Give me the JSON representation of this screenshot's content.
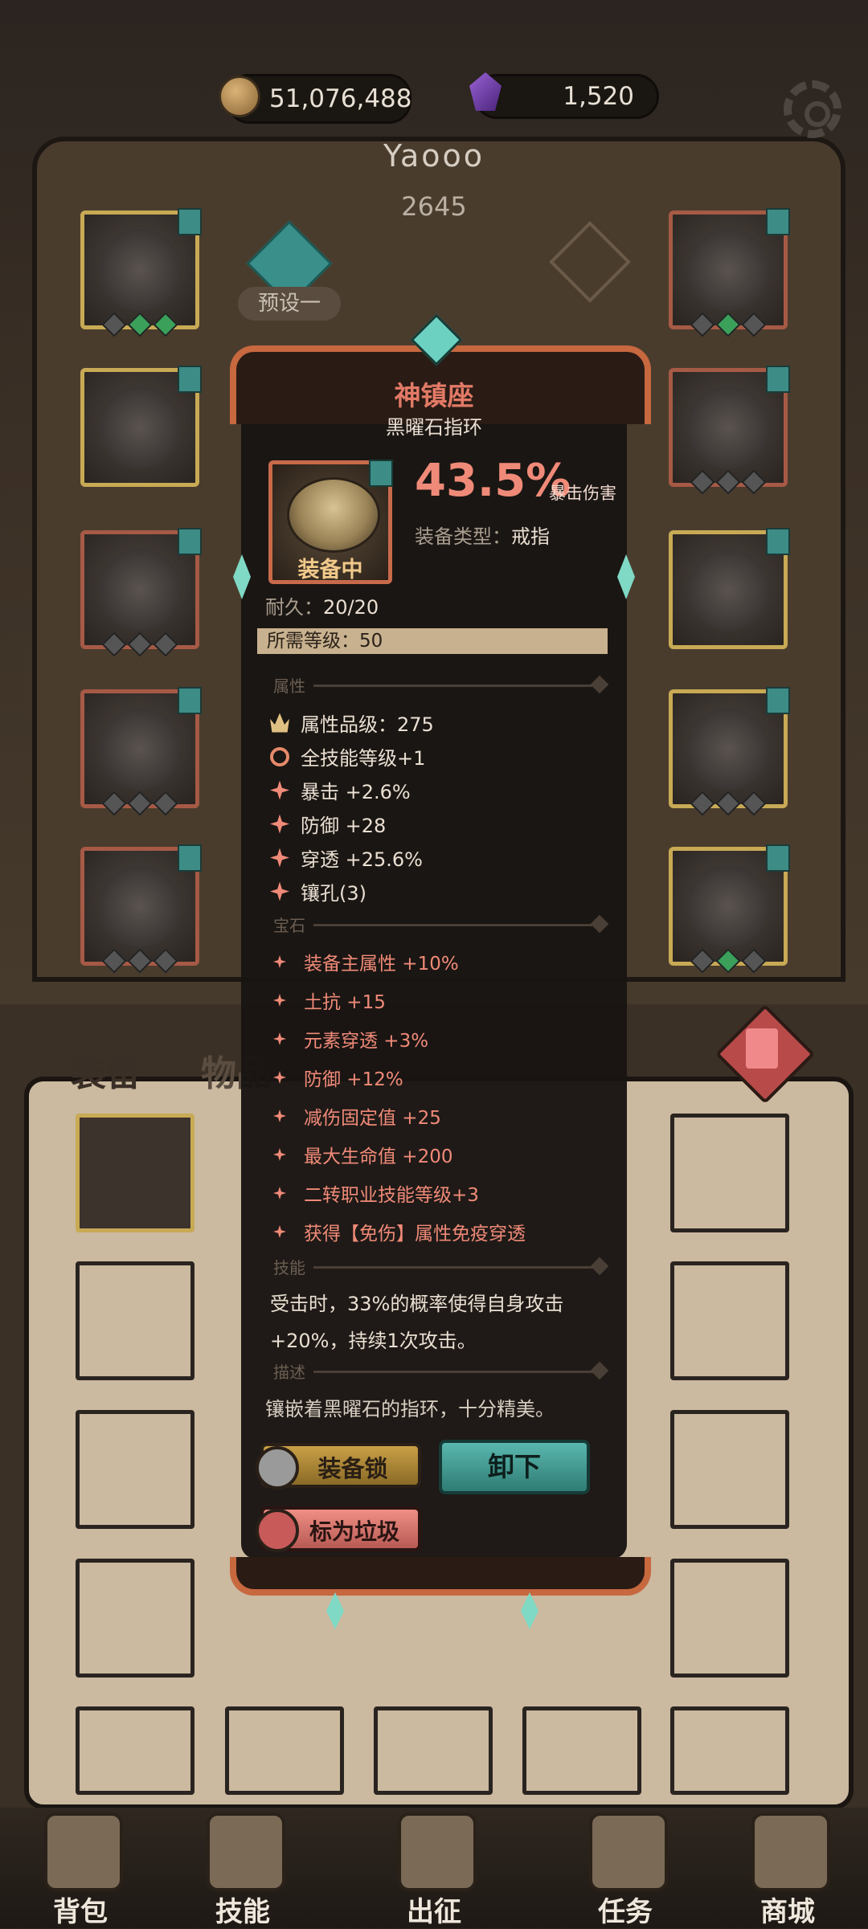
{
  "header": {
    "coins": "51,076,488",
    "gems": "1,520",
    "player_name": "Yaooo",
    "power": "2645",
    "preset_label": "预设一"
  },
  "inventory_tabs": {
    "equip": "装备",
    "items": "物品"
  },
  "tooltip": {
    "title": "神镇座",
    "subtitle": "黑曜石指环",
    "equipped_label": "装备中",
    "main_stat_value": "43.5%",
    "main_stat_label": "暴击伤害",
    "type_label": "装备类型：",
    "type_value": "戒指",
    "durability_label": "耐久：",
    "durability_value": "20/20",
    "level_label": "所需等级：",
    "level_value": "50",
    "sections": {
      "attributes": "属性",
      "gems": "宝石",
      "skill": "技能",
      "description": "描述"
    },
    "attributes": [
      "属性品级：275",
      "全技能等级+1",
      "暴击 +2.6%",
      "防御 +28",
      "穿透 +25.6%",
      "镶孔(3)"
    ],
    "gem_lines": [
      "装备主属性 +10%",
      "土抗 +15",
      "元素穿透 +3%",
      "防御 +12%",
      "减伤固定值 +25",
      "最大生命值 +200",
      "二转职业技能等级+3",
      "获得【免伤】属性免疫穿透"
    ],
    "skill_line1": "受击时，33%的概率使得自身攻击",
    "skill_line2": "+20%，持续1次攻击。",
    "description": "镶嵌着黑曜石的指环，十分精美。",
    "btn_lock": "装备锁",
    "btn_unequip": "卸下",
    "btn_junk": "标为垃圾"
  },
  "nav": [
    {
      "label": "背包",
      "icon": "backpack-icon"
    },
    {
      "label": "技能",
      "icon": "skill-book-icon"
    },
    {
      "label": "出征",
      "icon": "sword-map-icon"
    },
    {
      "label": "任务",
      "icon": "scroll-icon"
    },
    {
      "label": "商城",
      "icon": "shop-crown-icon"
    }
  ],
  "colors": {
    "accent_red": "#f08a78",
    "accent_teal": "#5ab8ae",
    "gold": "#c8aa55"
  }
}
